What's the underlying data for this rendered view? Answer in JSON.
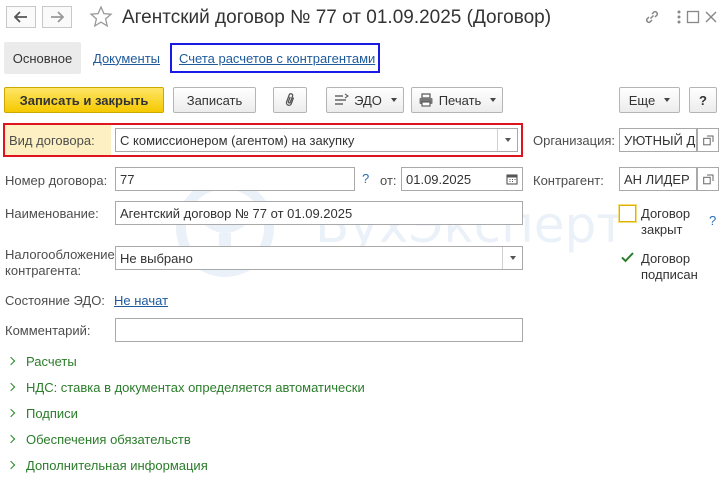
{
  "window": {
    "title": "Агентский договор № 77 от 01.09.2025 (Договор)",
    "icons": [
      "link-icon",
      "more-icon",
      "maximize-icon",
      "close-icon"
    ]
  },
  "tabs": [
    {
      "label": "Основное",
      "active": true
    },
    {
      "label": "Документы",
      "active": false
    },
    {
      "label": "Счета расчетов с контрагентами",
      "active": false
    }
  ],
  "toolbar": {
    "save_close": "Записать и закрыть",
    "save": "Записать",
    "edo": "ЭДО",
    "print": "Печать",
    "more": "Еще",
    "help": "?"
  },
  "form": {
    "contract_type": {
      "label": "Вид договора:",
      "value": "С комиссионером (агентом) на закупку"
    },
    "organization": {
      "label": "Организация:",
      "value": "УЮТНЫЙ ДОМ"
    },
    "number": {
      "label": "Номер договора:",
      "value": "77",
      "help": "?"
    },
    "date": {
      "label": "от:",
      "value": "01.09.2025"
    },
    "counterparty": {
      "label": "Контрагент:",
      "value": "АН ЛИДЕР"
    },
    "name": {
      "label": "Наименование:",
      "value": "Агентский договор № 77 от 01.09.2025"
    },
    "taxation": {
      "label_line1": "Налогообложение",
      "label_line2": "контрагента:",
      "value": "Не выбрано"
    },
    "edo_state": {
      "label": "Состояние ЭДО:",
      "value": "Не начат"
    },
    "comment": {
      "label": "Комментарий:",
      "value": ""
    },
    "closed": {
      "label_line1": "Договор",
      "label_line2": "закрыт",
      "checked": false,
      "help": "?"
    },
    "signed": {
      "label_line1": "Договор",
      "label_line2": "подписан",
      "checked": true
    }
  },
  "sections": [
    "Расчеты",
    "НДС: ставка в документах определяется автоматически",
    "Подписи",
    "Обеспечения обязательств",
    "Дополнительная информация"
  ],
  "watermark": {
    "text": "БухЭксперт"
  },
  "colors": {
    "accent_yellow": "#f5c900",
    "link_blue": "#1e5a9c",
    "section_green": "#2a7d2a",
    "highlight_red": "#e0141e",
    "highlight_blue": "#1a1ae6"
  }
}
